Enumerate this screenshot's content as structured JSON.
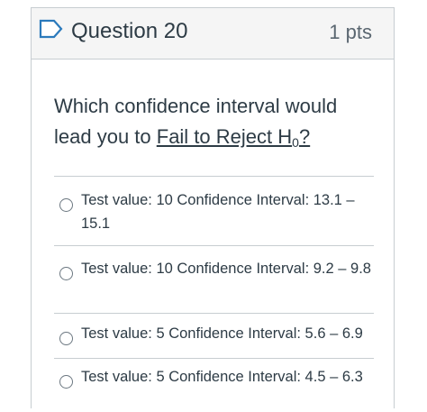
{
  "question": {
    "title": "Question 20",
    "points": "1 pts",
    "text_before": "Which confidence interval would lead you to ",
    "text_link": "Fail to Reject H",
    "text_sub": "0",
    "text_after": "?"
  },
  "answers": [
    {
      "label": "Test value: 10 Confidence Interval: 13.1 – 15.1",
      "selected": false
    },
    {
      "label": "Test value: 10 Confidence Interval: 9.2 – 9.8",
      "selected": false
    },
    {
      "label": "Test value: 5 Confidence Interval: 5.6 – 6.9",
      "selected": false
    },
    {
      "label": "Test value: 5 Confidence Interval: 4.5 – 6.3",
      "selected": false
    }
  ],
  "colors": {
    "flag_outline": "#2b7abc",
    "header_bg": "#f5f5f5",
    "border": "#c7cdd1"
  },
  "icons": {
    "flag": "bookmark-flag-icon",
    "radio": "radio-unchecked-icon"
  }
}
